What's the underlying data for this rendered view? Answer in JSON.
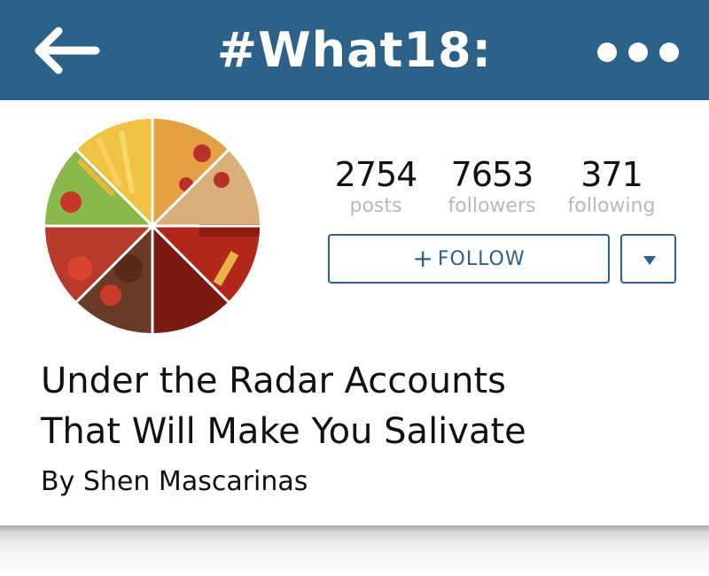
{
  "header": {
    "title": "#What18:",
    "back_icon": "arrow-left-icon",
    "menu_icon": "more-horizontal-icon",
    "background_color": "#2c6189"
  },
  "profile": {
    "avatar_description_icon": "food-collage-avatar",
    "stats": [
      {
        "value": "2754",
        "label": "posts"
      },
      {
        "value": "7653",
        "label": "followers"
      },
      {
        "value": "371",
        "label": "following"
      }
    ],
    "follow_button": {
      "icon": "+",
      "label": "FOLLOW"
    },
    "dropdown_icon": "triangle-down-icon"
  },
  "article": {
    "title_line1": "Under the Radar Accounts",
    "title_line2": "That Will Make You Salivate",
    "byline": "By Shen Mascarinas"
  },
  "colors": {
    "accent": "#2c6189",
    "label_gray": "#b9b9b9",
    "text": "#111111"
  }
}
